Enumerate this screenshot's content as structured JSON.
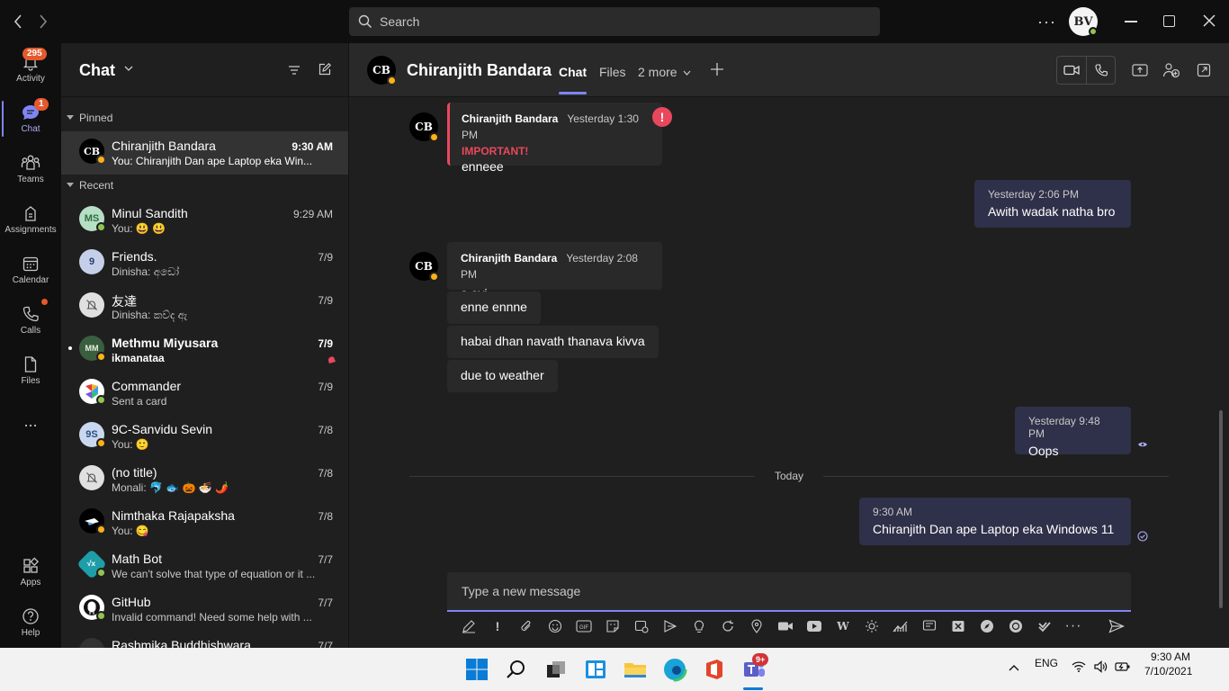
{
  "titlebar": {
    "search_placeholder": "Search",
    "user_initials": "BV"
  },
  "rail": {
    "items": [
      {
        "label": "Activity",
        "badge": "295"
      },
      {
        "label": "Chat",
        "badge": "1"
      },
      {
        "label": "Teams"
      },
      {
        "label": "Assignments"
      },
      {
        "label": "Calendar"
      },
      {
        "label": "Calls"
      },
      {
        "label": "Files"
      },
      {
        "label": "Apps"
      },
      {
        "label": "Help"
      }
    ],
    "more": "..."
  },
  "chatlist": {
    "title": "Chat",
    "pinned_label": "Pinned",
    "recent_label": "Recent",
    "pinned": [
      {
        "name": "Chiranjith Bandara",
        "preview": "You: Chiranjith Dan ape Laptop eka Win...",
        "time": "9:30 AM",
        "initials": "CB"
      }
    ],
    "recent": [
      {
        "name": "Minul Sandith",
        "preview": "You: 😃 😃",
        "time": "9:29 AM",
        "initials": "MS"
      },
      {
        "name": "Friends.",
        "preview": "Dinisha: අඩෝ",
        "time": "7/9",
        "initials": "9"
      },
      {
        "name": "友達",
        "preview": "Dinisha: කව්ද ඇ",
        "time": "7/9",
        "initials": ""
      },
      {
        "name": "Methmu Miyusara",
        "preview": "ikmanataa",
        "time": "7/9",
        "initials": "MM"
      },
      {
        "name": "Commander",
        "preview": "Sent a card",
        "time": "7/9",
        "initials": ""
      },
      {
        "name": "9C-Sanvidu Sevin",
        "preview": "You: 🙂",
        "time": "7/8",
        "initials": "9S"
      },
      {
        "name": "(no title)",
        "preview": "Monali: 🐬 🐟 🎃 🍜 🌶️",
        "time": "7/8",
        "initials": ""
      },
      {
        "name": "Nimthaka Rajapaksha",
        "preview": "You: 😋",
        "time": "7/8",
        "initials": ""
      },
      {
        "name": "Math Bot",
        "preview": "We can't solve that type of equation or it ...",
        "time": "7/7",
        "initials": "√x"
      },
      {
        "name": "GitHub",
        "preview": "Invalid command! Need some help with ...",
        "time": "7/7",
        "initials": ""
      },
      {
        "name": "Rashmika Buddhishwara",
        "preview": "",
        "time": "7/7",
        "initials": ""
      }
    ]
  },
  "conversation": {
    "name": "Chiranjith Bandara",
    "avatar_initials": "CB",
    "tabs": [
      "Chat",
      "Files",
      "2 more"
    ],
    "messages": {
      "m1": {
        "sender": "Chiranjith Bandara",
        "time": "Yesterday 1:30 PM",
        "flag": "IMPORTANT!",
        "text": "enneee"
      },
      "m2": {
        "time": "Yesterday 2:06 PM",
        "text": "Awith wadak natha bro"
      },
      "m3": {
        "sender": "Chiranjith Bandara",
        "time": "Yesterday 2:08 PM",
        "text": "a ayi"
      },
      "m4": {
        "text": "enne ennne"
      },
      "m5": {
        "text": "habai dhan navath thanava kivva"
      },
      "m6": {
        "text": "due to weather"
      },
      "m7": {
        "time": "Yesterday 9:48 PM",
        "text": "Oops"
      },
      "divider": "Today",
      "m8": {
        "time": "9:30 AM",
        "text": "Chiranjith Dan ape Laptop eka Windows 11"
      }
    },
    "compose_placeholder": "Type a new message"
  },
  "taskbar": {
    "lang": "ENG",
    "time": "9:30 AM",
    "date": "7/10/2021",
    "teams_badge": "9+"
  },
  "colors": {
    "accent": "#7f85f5",
    "important": "#e9485c",
    "badge": "#e5592c",
    "online": "#92c353",
    "away": "#fcb116"
  }
}
